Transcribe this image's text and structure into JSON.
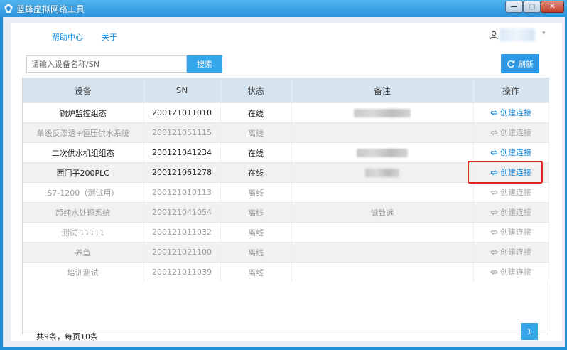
{
  "window": {
    "title": "蓝蜂虚拟网络工具",
    "min_glyph": "—",
    "max_glyph": "□",
    "close_glyph": "✕"
  },
  "nav": {
    "help": "帮助中心",
    "about": "关于",
    "user_caret": "▾"
  },
  "toolbar": {
    "search_placeholder": "请输入设备名称/SN",
    "search_label": "搜索",
    "refresh_label": "刷新"
  },
  "table": {
    "headers": [
      "设备",
      "SN",
      "状态",
      "备注",
      "操作"
    ],
    "rows": [
      {
        "device": "锅炉监控组态",
        "sn": "200121011010",
        "status": "在线",
        "note": "",
        "action": "创建连接"
      },
      {
        "device": "单级反渗透+恒压供水系统",
        "sn": "200121051115",
        "status": "离线",
        "note": "",
        "action": "创建连接"
      },
      {
        "device": "二次供水机组组态",
        "sn": "200121041234",
        "status": "在线",
        "note": "",
        "action": "创建连接"
      },
      {
        "device": "西门子200PLC",
        "sn": "200121061278",
        "status": "在线",
        "note": "",
        "action": "创建连接"
      },
      {
        "device": "S7-1200（测试用）",
        "sn": "200121010113",
        "status": "离线",
        "note": "",
        "action": "创建连接"
      },
      {
        "device": "超纯水处理系统",
        "sn": "200121041054",
        "status": "离线",
        "note": "诚致远",
        "action": "创建连接"
      },
      {
        "device": "测试 11111",
        "sn": "200121011032",
        "status": "离线",
        "note": "",
        "action": "创建连接"
      },
      {
        "device": "养鱼",
        "sn": "200121021100",
        "status": "离线",
        "note": "",
        "action": "创建连接"
      },
      {
        "device": "培训测试",
        "sn": "200121011039",
        "status": "离线",
        "note": "",
        "action": "创建连接"
      }
    ]
  },
  "footer": {
    "count_text": "共9条，每页10条",
    "current_page": "1"
  },
  "colors": {
    "accent": "#36a6ea",
    "link": "#1a8ee0",
    "highlight": "#e0241e",
    "header_bg": "#d6e4ef"
  }
}
